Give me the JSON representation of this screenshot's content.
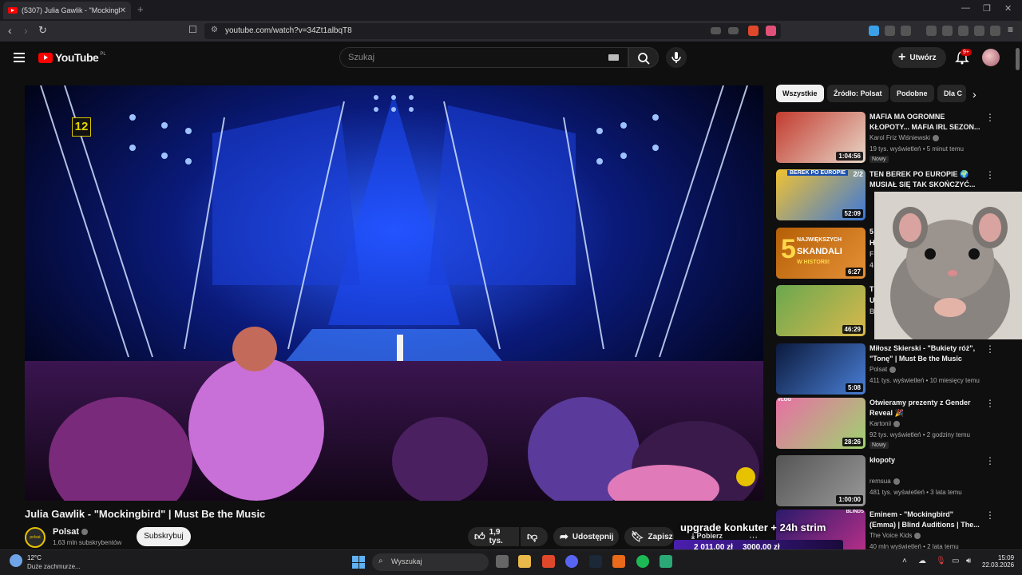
{
  "browser": {
    "tab_title": "(5307) Julia Gawlik - \"Mockingb...",
    "url": "youtube.com/watch?v=34Zt1albqT8"
  },
  "header": {
    "logo_text": "YouTube",
    "region": "PL",
    "search_placeholder": "Szukaj",
    "create_label": "Utwórz",
    "notifications_badge": "9+"
  },
  "video": {
    "age_rating": "12",
    "title": "Julia Gawlik - \"Mockingbird\" | Must Be the Music",
    "channel": "Polsat",
    "channel_logo_text": "polsat",
    "subscribers": "1,63 mln subskrybentów",
    "subscribe_label": "Subskrybuj",
    "likes": "1,9 tys.",
    "share_label": "Udostępnij",
    "save_label": "Zapisz",
    "download_label": "Pobierz"
  },
  "chips": [
    "Wszystkie",
    "Źródło: Polsat",
    "Podobne",
    "Dla C"
  ],
  "recommendations": [
    {
      "title": "MAFIA MA OGROMNE KŁOPOTY... MAFIA IRL SEZON...",
      "channel": "Karol Friz Wiśniewski",
      "meta": "19 tys. wyświetleń • 5 minut temu",
      "badge": "Nowy",
      "duration": "1:04:56",
      "colors": [
        "#c23b2f",
        "#e8d7c8"
      ]
    },
    {
      "title": "TEN BEREK PO EUROPIE 🌍 MUSIAŁ SIĘ TAK SKOŃCZYĆ...",
      "channel": "",
      "meta": "",
      "badge": "",
      "duration": "52:09",
      "colors": [
        "#f1c232",
        "#3c78d8"
      ]
    },
    {
      "title": "",
      "channel": "",
      "meta": "",
      "badge": "",
      "duration": "6:27",
      "colors": [
        "#b45f06",
        "#e69138"
      ]
    },
    {
      "title": "",
      "channel": "",
      "meta": "",
      "badge": "",
      "duration": "46:29",
      "colors": [
        "#6aa84f",
        "#d9b84c"
      ]
    },
    {
      "title": "Miłosz Skierski - \"Bukiety róż\", \"Tonę\" | Must Be the Music",
      "channel": "Polsat",
      "meta": "411 tys. wyświetleń • 10 miesięcy temu",
      "badge": "",
      "duration": "5:08",
      "colors": [
        "#0b1a3d",
        "#4a7fd6"
      ]
    },
    {
      "title": "Otwieramy prezenty z Gender Reveal 🎉",
      "channel": "Kartonii",
      "meta": "92 tys. wyświetleń • 2 godziny temu",
      "badge": "Nowy",
      "duration": "28:26",
      "colors": [
        "#e86fa5",
        "#9fd36f"
      ]
    },
    {
      "title": "kłopoty",
      "channel": "remsua",
      "meta": "481 tys. wyświetleń • 3 lata temu",
      "badge": "",
      "duration": "1:00:00",
      "colors": [
        "#555555",
        "#999999"
      ]
    },
    {
      "title": "Eminem - \"Mockingbird\" (Emma) | Blind Auditions | The...",
      "channel": "The Voice Kids",
      "meta": "40 mln wyświetleń • 2 lata temu",
      "badge": "",
      "duration": "",
      "colors": [
        "#2a1a6b",
        "#c0308a"
      ]
    }
  ],
  "thumb_texts": {
    "t2_corner": "2/2",
    "t2_banner": "BEREK PO EUROPIE",
    "t3_big": "5",
    "t3_line1": "NAJWIĘKSZYCH",
    "t3_line2": "SKANDALI",
    "t3_line3": "W HISTORII!",
    "t6_tag": "VLOG",
    "t8_tag": "BLINDS"
  },
  "partial_titles": {
    "t3_letters": [
      "5",
      "H",
      "F",
      "4"
    ],
    "t4_letters": [
      "T",
      "U",
      "B"
    ]
  },
  "overlay": {
    "title": "upgrade konkuter + 24h strim",
    "amount_current": "2 011,00 zł",
    "amount_goal": "3000,00 zł"
  },
  "taskbar": {
    "temperature": "12°C",
    "weather": "Duże zachmurze...",
    "search_label": "Wyszukaj",
    "time": "15:09",
    "date": "22.03.2026"
  }
}
